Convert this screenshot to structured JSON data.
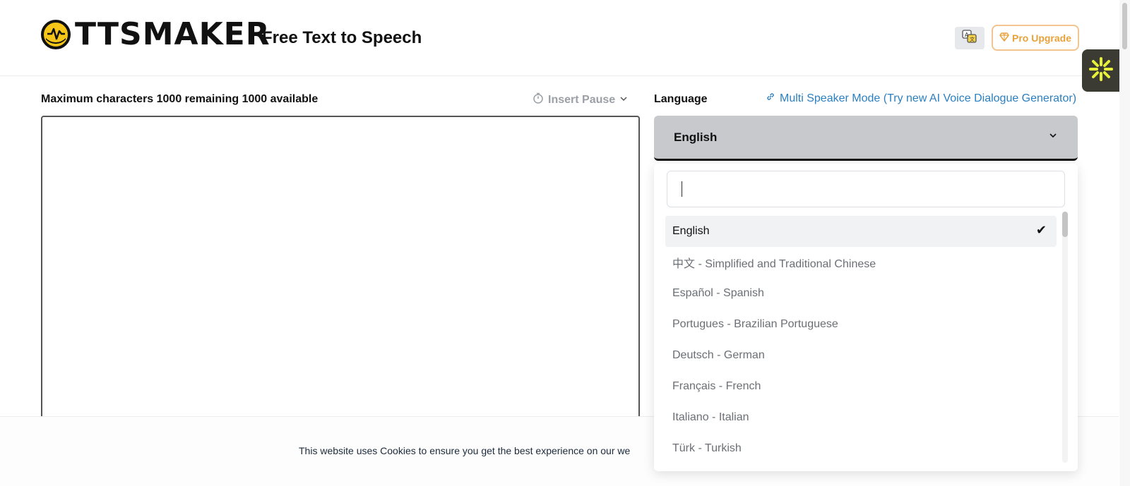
{
  "header": {
    "logo_text": "TTSMAKER",
    "tagline": "Free Text to Speech",
    "pro_button_label": "Pro Upgrade"
  },
  "editor": {
    "char_info": "Maximum characters 1000 remaining 1000 available",
    "insert_pause_label": "Insert Pause",
    "text_value": ""
  },
  "language": {
    "label": "Language",
    "multi_speaker_link": "Multi Speaker Mode (Try new AI Voice Dialogue Generator)",
    "selected": "English",
    "search_value": "",
    "options": [
      "English",
      "中文 - Simplified and Traditional Chinese",
      "Español - Spanish",
      "Portugues - Brazilian Portuguese",
      "Deutsch - German",
      "Français - French",
      "Italiano - Italian",
      "Türk - Turkish"
    ]
  },
  "cookie": {
    "text": "This website uses Cookies to ensure you get the best experience on our we"
  },
  "colors": {
    "accent_blue": "#2a7fc0",
    "pro_orange": "#e8a23b",
    "logo_yellow": "#f5c518",
    "select_bg": "#c8c9cc"
  },
  "icons": {
    "logo": "waveform-icon",
    "translate": "translate-icon",
    "pro": "diamond-icon",
    "pause": "timer-icon",
    "chevron": "chevron-down-icon",
    "link": "link-icon",
    "check": "check-icon",
    "widget": "sparkle-icon"
  }
}
